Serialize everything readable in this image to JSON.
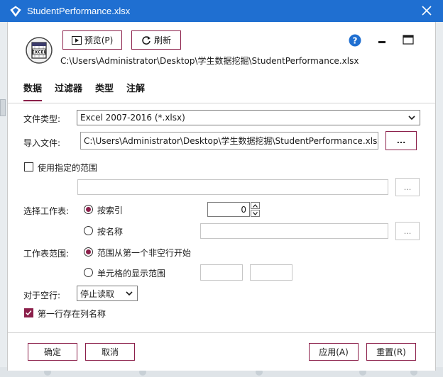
{
  "window": {
    "title": "StudentPerformance.xlsx"
  },
  "header": {
    "preview_label": "预览(P)",
    "refresh_label": "刷新",
    "file_path": "C:\\Users\\Administrator\\Desktop\\学生数据挖掘\\StudentPerformance.xlsx",
    "help_icon": "help-icon",
    "accent_color": "#8b1f4a",
    "titlebar_color": "#1f6fd1"
  },
  "tabs": [
    {
      "label": "数据",
      "active": true
    },
    {
      "label": "过滤器",
      "active": false
    },
    {
      "label": "类型",
      "active": false
    },
    {
      "label": "注解",
      "active": false
    }
  ],
  "form": {
    "file_type_label": "文件类型:",
    "file_type_value": "Excel 2007-2016 (*.xlsx)",
    "import_file_label": "导入文件:",
    "import_file_value": "C:\\Users\\Administrator\\Desktop\\学生数据挖掘\\StudentPerformance.xlsx",
    "browse_label": "...",
    "use_range_label": "使用指定的范围",
    "range_browse_label": "...",
    "select_sheet_label": "选择工作表:",
    "by_index_label": "按索引",
    "index_value": "0",
    "by_name_label": "按名称",
    "name_browse_label": "...",
    "sheet_range_label": "工作表范围:",
    "first_nonblank_label": "范围从第一个非空行开始",
    "cell_range_label": "单元格的显示范围",
    "blank_rows_label": "对于空行:",
    "blank_rows_value": "停止读取",
    "first_row_names_label": "第一行存在列名称"
  },
  "footer": {
    "ok_label": "确定",
    "cancel_label": "取消",
    "apply_label": "应用(A)",
    "reset_label": "重置(R)"
  }
}
